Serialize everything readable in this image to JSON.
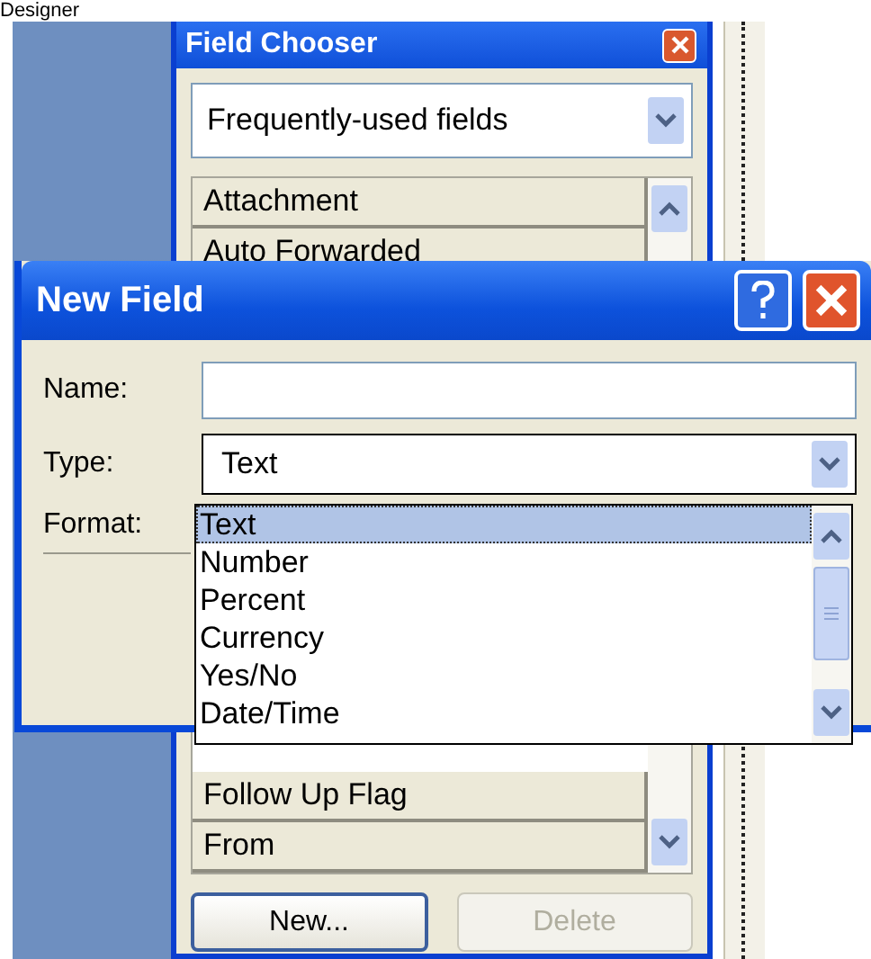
{
  "page_heading": "Designer",
  "field_chooser": {
    "title": "Field Chooser",
    "category": "Frequently-used fields",
    "fields": [
      {
        "label": "Attachment"
      },
      {
        "label": "Auto Forwarded"
      }
    ],
    "fields_after_gap": [
      {
        "label": "Follow Up Flag"
      },
      {
        "label": "From"
      }
    ],
    "buttons": [
      {
        "label": "New...",
        "disabled": false
      },
      {
        "label": "Delete",
        "disabled": true
      }
    ]
  },
  "new_field": {
    "title": "New Field",
    "name": {
      "label": "Name:"
    },
    "type": {
      "label": "Type:",
      "value": "Text",
      "expanded": true,
      "options": [
        {
          "label": "Text",
          "selected": true
        },
        {
          "label": "Number",
          "selected": false
        },
        {
          "label": "Percent",
          "selected": false
        },
        {
          "label": "Currency",
          "selected": false
        },
        {
          "label": "Yes/No",
          "selected": false
        },
        {
          "label": "Date/Time",
          "selected": false
        }
      ]
    },
    "format": {
      "label": "Format:"
    }
  }
}
